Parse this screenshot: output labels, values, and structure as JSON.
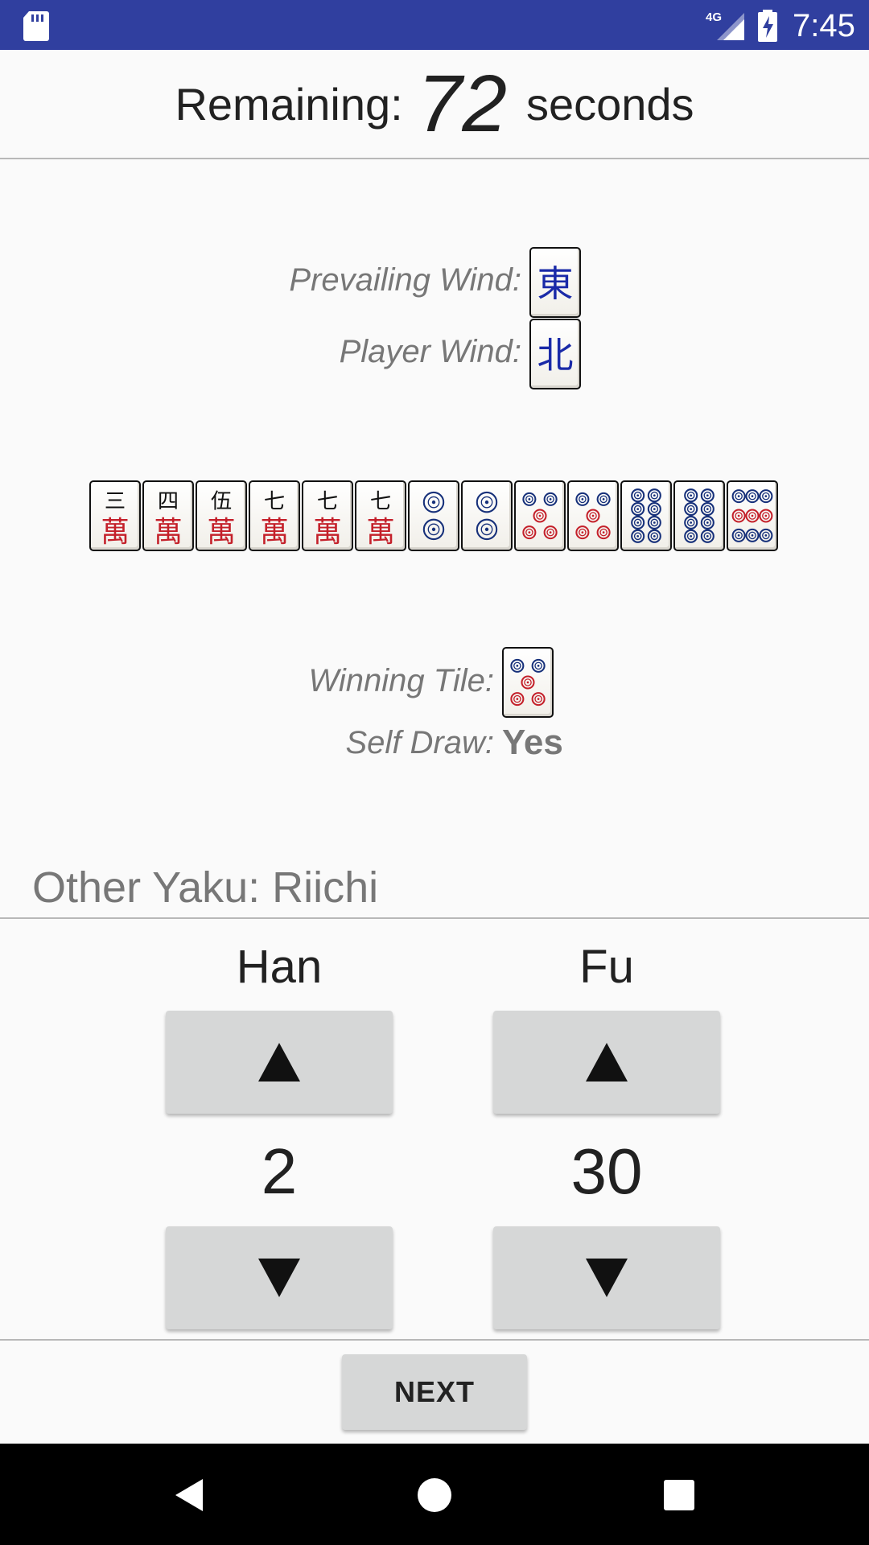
{
  "status_bar": {
    "time": "7:45",
    "network": "4G"
  },
  "timer": {
    "prefix": "Remaining:",
    "value": "72",
    "suffix": "seconds"
  },
  "winds": {
    "prevailing_label": "Prevailing Wind:",
    "prevailing_tile": "east-wind",
    "player_label": "Player Wind:",
    "player_tile": "north-wind"
  },
  "hand": {
    "tiles": [
      "3-man",
      "4-man",
      "5-man",
      "7-man",
      "7-man",
      "7-man",
      "2-pin",
      "2-pin",
      "5-pin",
      "5-pin",
      "8-pin",
      "8-pin",
      "9-pin"
    ]
  },
  "winning": {
    "label": "Winning Tile:",
    "tile": "5-pin"
  },
  "self_draw": {
    "label": "Self Draw:",
    "value": "Yes"
  },
  "other_yaku": {
    "text": "Other Yaku: Riichi"
  },
  "han": {
    "label": "Han",
    "value": "2"
  },
  "fu": {
    "label": "Fu",
    "value": "30"
  },
  "next_button": {
    "label": "NEXT"
  },
  "colors": {
    "status_bar": "#303f9f",
    "wind_glyph": "#1a2aa8",
    "man_red": "#c4202a",
    "pin_blue": "#16307a",
    "pin_red": "#c4202a"
  },
  "icons": {
    "sd_card": "sd-card-icon",
    "signal": "signal-icon",
    "battery": "battery-charging-icon",
    "up": "triangle-up-icon",
    "down": "triangle-down-icon",
    "back": "nav-back-icon",
    "home": "nav-home-icon",
    "recent": "nav-recent-icon"
  }
}
